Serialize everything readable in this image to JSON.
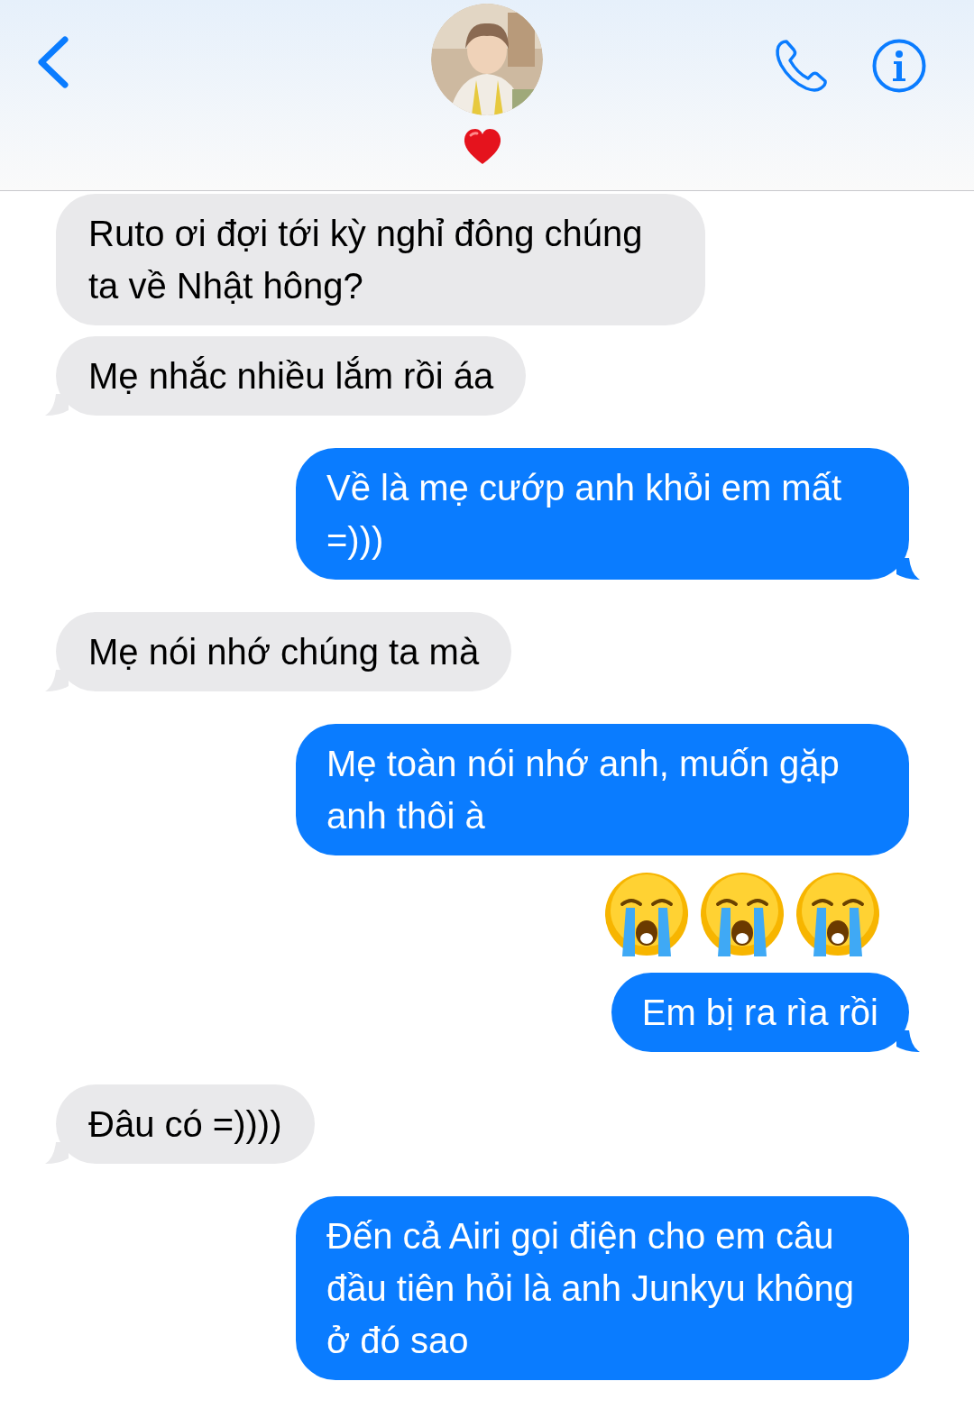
{
  "messages": [
    {
      "from_me": false,
      "kind": "text",
      "text": "Ruto ơi đợi tới kỳ nghỉ đông chúng ta về Nhật hông?",
      "tail": false
    },
    {
      "from_me": false,
      "kind": "text",
      "text": "Mẹ nhắc nhiều lắm rồi áa",
      "tail": true
    },
    {
      "from_me": true,
      "kind": "text",
      "text": "Về là mẹ cướp anh khỏi em mất =)))",
      "tail": true
    },
    {
      "from_me": false,
      "kind": "text",
      "text": "Mẹ nói nhớ chúng ta mà",
      "tail": true
    },
    {
      "from_me": true,
      "kind": "text",
      "text": "Mẹ toàn nói nhớ anh, muốn gặp anh thôi à",
      "tail": false
    },
    {
      "from_me": true,
      "kind": "emoji",
      "emojis": [
        {
          "kind": "crying"
        },
        {
          "kind": "crying"
        },
        {
          "kind": "crying"
        }
      ]
    },
    {
      "from_me": true,
      "kind": "text",
      "text": "Em bị ra rìa rồi",
      "tail": true
    },
    {
      "from_me": false,
      "kind": "text",
      "text": "Đâu có =))))",
      "tail": true
    },
    {
      "from_me": true,
      "kind": "text",
      "text": "Đến cả Airi gọi điện cho em câu đầu tiên hỏi là anh Junkyu không ở đó sao",
      "tail": false
    }
  ]
}
